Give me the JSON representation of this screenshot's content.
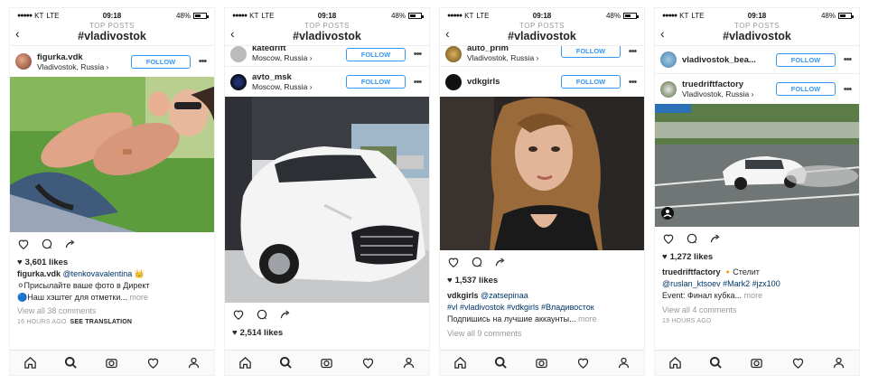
{
  "status": {
    "carrier": "KT",
    "network": "LTE",
    "time": "09:18",
    "battery": "48%"
  },
  "header": {
    "subtitle": "TOP POSTS",
    "hashtag": "#vladivostok"
  },
  "screens": [
    {
      "post": {
        "username": "figurka.vdk",
        "location": "Vladivostok, Russia",
        "follow": "FOLLOW",
        "likes": "3,601 likes",
        "caption_user": "figurka.vdk",
        "caption_mention": "@tenkovavalentina",
        "caption_emoji": "👑",
        "line2": "Присылайте ваше фото в Директ",
        "line3": "Наш хэштег для отметки...",
        "more": "more",
        "comments": "View all 38 comments",
        "time": "16 HOURS AGO",
        "see_translation": "SEE TRANSLATION"
      }
    },
    {
      "prev": {
        "username": "katedrift",
        "location": "Moscow, Russia",
        "follow": "FOLLOW"
      },
      "post": {
        "username": "avto_msk",
        "location": "Moscow, Russia",
        "follow": "FOLLOW",
        "likes": "2,514 likes"
      }
    },
    {
      "prev": {
        "username": "auto_prim",
        "location": "Vladivostok, Russia",
        "follow": "FOLLOW"
      },
      "post": {
        "username": "vdkgirls",
        "follow": "FOLLOW",
        "likes": "1,537 likes",
        "caption_user": "vdkgirls",
        "caption_mention": "@zatsepinaa",
        "tags": "#vl #vladivostok #vdkgirls #Владивосток",
        "line3": "Подпишись на лучшие аккаунты...",
        "more": "more",
        "comments": "View all 9 comments"
      }
    },
    {
      "prev": {
        "username": "vladivostok_bea...",
        "follow": "FOLLOW"
      },
      "post": {
        "username": "truedriftfactory",
        "location": "Vladivostok, Russia",
        "follow": "FOLLOW",
        "likes": "1,272 likes",
        "caption_user": "truedriftfactory",
        "caption_rest": "Стелит",
        "mentions": "@ruslan_ktsoev #Mark2 #jzx100",
        "line3": "Event: Финал кубка...",
        "more": "more",
        "comments": "View all 4 comments",
        "time": "19 HOURS AGO"
      }
    }
  ],
  "icons": {
    "back": "chevron-left-icon",
    "more": "ellipsis-icon",
    "heart": "heart-icon",
    "comment": "comment-icon",
    "share": "share-icon",
    "home": "home-icon",
    "search": "search-icon",
    "camera": "camera-icon",
    "activity": "heart-icon",
    "profile": "profile-icon"
  },
  "colors": {
    "accent": "#3897f0",
    "link": "#003569",
    "muted": "#999999"
  }
}
